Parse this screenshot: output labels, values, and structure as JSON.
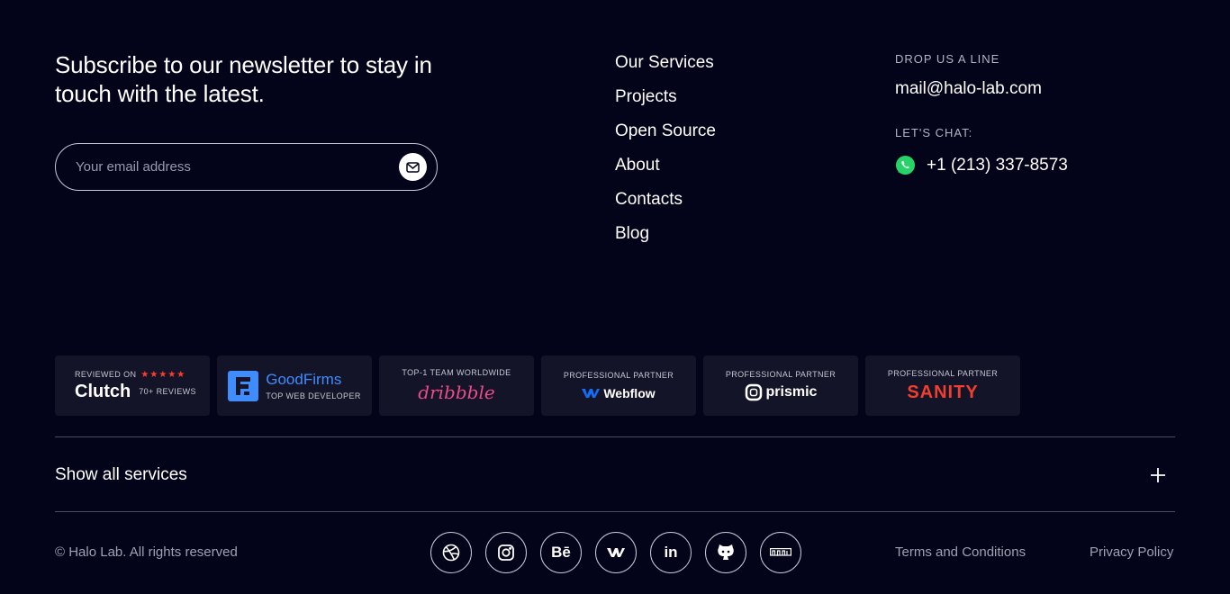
{
  "newsletter": {
    "title": "Subscribe to our newsletter to stay in touch with the latest.",
    "placeholder": "Your email address",
    "submit_icon": "mail-icon"
  },
  "nav": {
    "items": [
      "Our Services",
      "Projects",
      "Open Source",
      "About",
      "Contacts",
      "Blog"
    ]
  },
  "contact": {
    "drop_label": "DROP US A LINE",
    "email": "mail@halo-lab.com",
    "chat_label": "LET'S CHAT:",
    "phone": "+1 (213) 337-8573",
    "chat_icon": "whatsapp-icon"
  },
  "badges": [
    {
      "caption": "REVIEWED ON",
      "logo": "Clutch",
      "sub": "70+ REVIEWS",
      "stars": "★★★★★",
      "stars_color": "#ff3d2e"
    },
    {
      "logo": "GoodFirms",
      "sub": "TOP WEB DEVELOPER",
      "color": "#3f8cff"
    },
    {
      "caption": "TOP-1 TEAM WORLDWIDE",
      "logo": "dribbble",
      "color": "#ea4c89"
    },
    {
      "caption": "PROFESSIONAL PARTNER",
      "logo": "Webflow",
      "color": "#146ef5"
    },
    {
      "caption": "PROFESSIONAL PARTNER",
      "logo": "prismic"
    },
    {
      "caption": "PROFESSIONAL PARTNER",
      "logo": "SANITY",
      "color": "#f03e2f"
    }
  ],
  "services": {
    "label": "Show all services",
    "toggle": "+"
  },
  "footer": {
    "copyright": "© Halo Lab. All rights reserved",
    "terms": "Terms and Conditions",
    "privacy": "Privacy Policy",
    "socials": [
      "dribbble-icon",
      "instagram-icon",
      "behance-icon",
      "webflow-icon",
      "linkedin-icon",
      "github-icon",
      "npm-icon"
    ],
    "behance_text": "Bē",
    "linkedin_text": "in"
  },
  "colors": {
    "background": "#03031a",
    "badge_background": "#141428"
  }
}
